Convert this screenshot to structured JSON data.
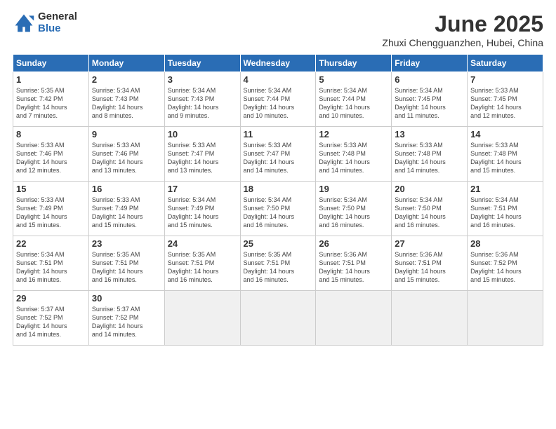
{
  "logo": {
    "general": "General",
    "blue": "Blue"
  },
  "title": "June 2025",
  "subtitle": "Zhuxi Chengguanzhen, Hubei, China",
  "headers": [
    "Sunday",
    "Monday",
    "Tuesday",
    "Wednesday",
    "Thursday",
    "Friday",
    "Saturday"
  ],
  "weeks": [
    [
      {
        "day": "1",
        "info": "Sunrise: 5:35 AM\nSunset: 7:42 PM\nDaylight: 14 hours\nand 7 minutes."
      },
      {
        "day": "2",
        "info": "Sunrise: 5:34 AM\nSunset: 7:43 PM\nDaylight: 14 hours\nand 8 minutes."
      },
      {
        "day": "3",
        "info": "Sunrise: 5:34 AM\nSunset: 7:43 PM\nDaylight: 14 hours\nand 9 minutes."
      },
      {
        "day": "4",
        "info": "Sunrise: 5:34 AM\nSunset: 7:44 PM\nDaylight: 14 hours\nand 10 minutes."
      },
      {
        "day": "5",
        "info": "Sunrise: 5:34 AM\nSunset: 7:44 PM\nDaylight: 14 hours\nand 10 minutes."
      },
      {
        "day": "6",
        "info": "Sunrise: 5:34 AM\nSunset: 7:45 PM\nDaylight: 14 hours\nand 11 minutes."
      },
      {
        "day": "7",
        "info": "Sunrise: 5:33 AM\nSunset: 7:45 PM\nDaylight: 14 hours\nand 12 minutes."
      }
    ],
    [
      {
        "day": "8",
        "info": "Sunrise: 5:33 AM\nSunset: 7:46 PM\nDaylight: 14 hours\nand 12 minutes."
      },
      {
        "day": "9",
        "info": "Sunrise: 5:33 AM\nSunset: 7:46 PM\nDaylight: 14 hours\nand 13 minutes."
      },
      {
        "day": "10",
        "info": "Sunrise: 5:33 AM\nSunset: 7:47 PM\nDaylight: 14 hours\nand 13 minutes."
      },
      {
        "day": "11",
        "info": "Sunrise: 5:33 AM\nSunset: 7:47 PM\nDaylight: 14 hours\nand 14 minutes."
      },
      {
        "day": "12",
        "info": "Sunrise: 5:33 AM\nSunset: 7:48 PM\nDaylight: 14 hours\nand 14 minutes."
      },
      {
        "day": "13",
        "info": "Sunrise: 5:33 AM\nSunset: 7:48 PM\nDaylight: 14 hours\nand 14 minutes."
      },
      {
        "day": "14",
        "info": "Sunrise: 5:33 AM\nSunset: 7:48 PM\nDaylight: 14 hours\nand 15 minutes."
      }
    ],
    [
      {
        "day": "15",
        "info": "Sunrise: 5:33 AM\nSunset: 7:49 PM\nDaylight: 14 hours\nand 15 minutes."
      },
      {
        "day": "16",
        "info": "Sunrise: 5:33 AM\nSunset: 7:49 PM\nDaylight: 14 hours\nand 15 minutes."
      },
      {
        "day": "17",
        "info": "Sunrise: 5:34 AM\nSunset: 7:49 PM\nDaylight: 14 hours\nand 15 minutes."
      },
      {
        "day": "18",
        "info": "Sunrise: 5:34 AM\nSunset: 7:50 PM\nDaylight: 14 hours\nand 16 minutes."
      },
      {
        "day": "19",
        "info": "Sunrise: 5:34 AM\nSunset: 7:50 PM\nDaylight: 14 hours\nand 16 minutes."
      },
      {
        "day": "20",
        "info": "Sunrise: 5:34 AM\nSunset: 7:50 PM\nDaylight: 14 hours\nand 16 minutes."
      },
      {
        "day": "21",
        "info": "Sunrise: 5:34 AM\nSunset: 7:51 PM\nDaylight: 14 hours\nand 16 minutes."
      }
    ],
    [
      {
        "day": "22",
        "info": "Sunrise: 5:34 AM\nSunset: 7:51 PM\nDaylight: 14 hours\nand 16 minutes."
      },
      {
        "day": "23",
        "info": "Sunrise: 5:35 AM\nSunset: 7:51 PM\nDaylight: 14 hours\nand 16 minutes."
      },
      {
        "day": "24",
        "info": "Sunrise: 5:35 AM\nSunset: 7:51 PM\nDaylight: 14 hours\nand 16 minutes."
      },
      {
        "day": "25",
        "info": "Sunrise: 5:35 AM\nSunset: 7:51 PM\nDaylight: 14 hours\nand 16 minutes."
      },
      {
        "day": "26",
        "info": "Sunrise: 5:36 AM\nSunset: 7:51 PM\nDaylight: 14 hours\nand 15 minutes."
      },
      {
        "day": "27",
        "info": "Sunrise: 5:36 AM\nSunset: 7:51 PM\nDaylight: 14 hours\nand 15 minutes."
      },
      {
        "day": "28",
        "info": "Sunrise: 5:36 AM\nSunset: 7:52 PM\nDaylight: 14 hours\nand 15 minutes."
      }
    ],
    [
      {
        "day": "29",
        "info": "Sunrise: 5:37 AM\nSunset: 7:52 PM\nDaylight: 14 hours\nand 14 minutes."
      },
      {
        "day": "30",
        "info": "Sunrise: 5:37 AM\nSunset: 7:52 PM\nDaylight: 14 hours\nand 14 minutes."
      },
      {
        "day": "",
        "info": ""
      },
      {
        "day": "",
        "info": ""
      },
      {
        "day": "",
        "info": ""
      },
      {
        "day": "",
        "info": ""
      },
      {
        "day": "",
        "info": ""
      }
    ]
  ]
}
